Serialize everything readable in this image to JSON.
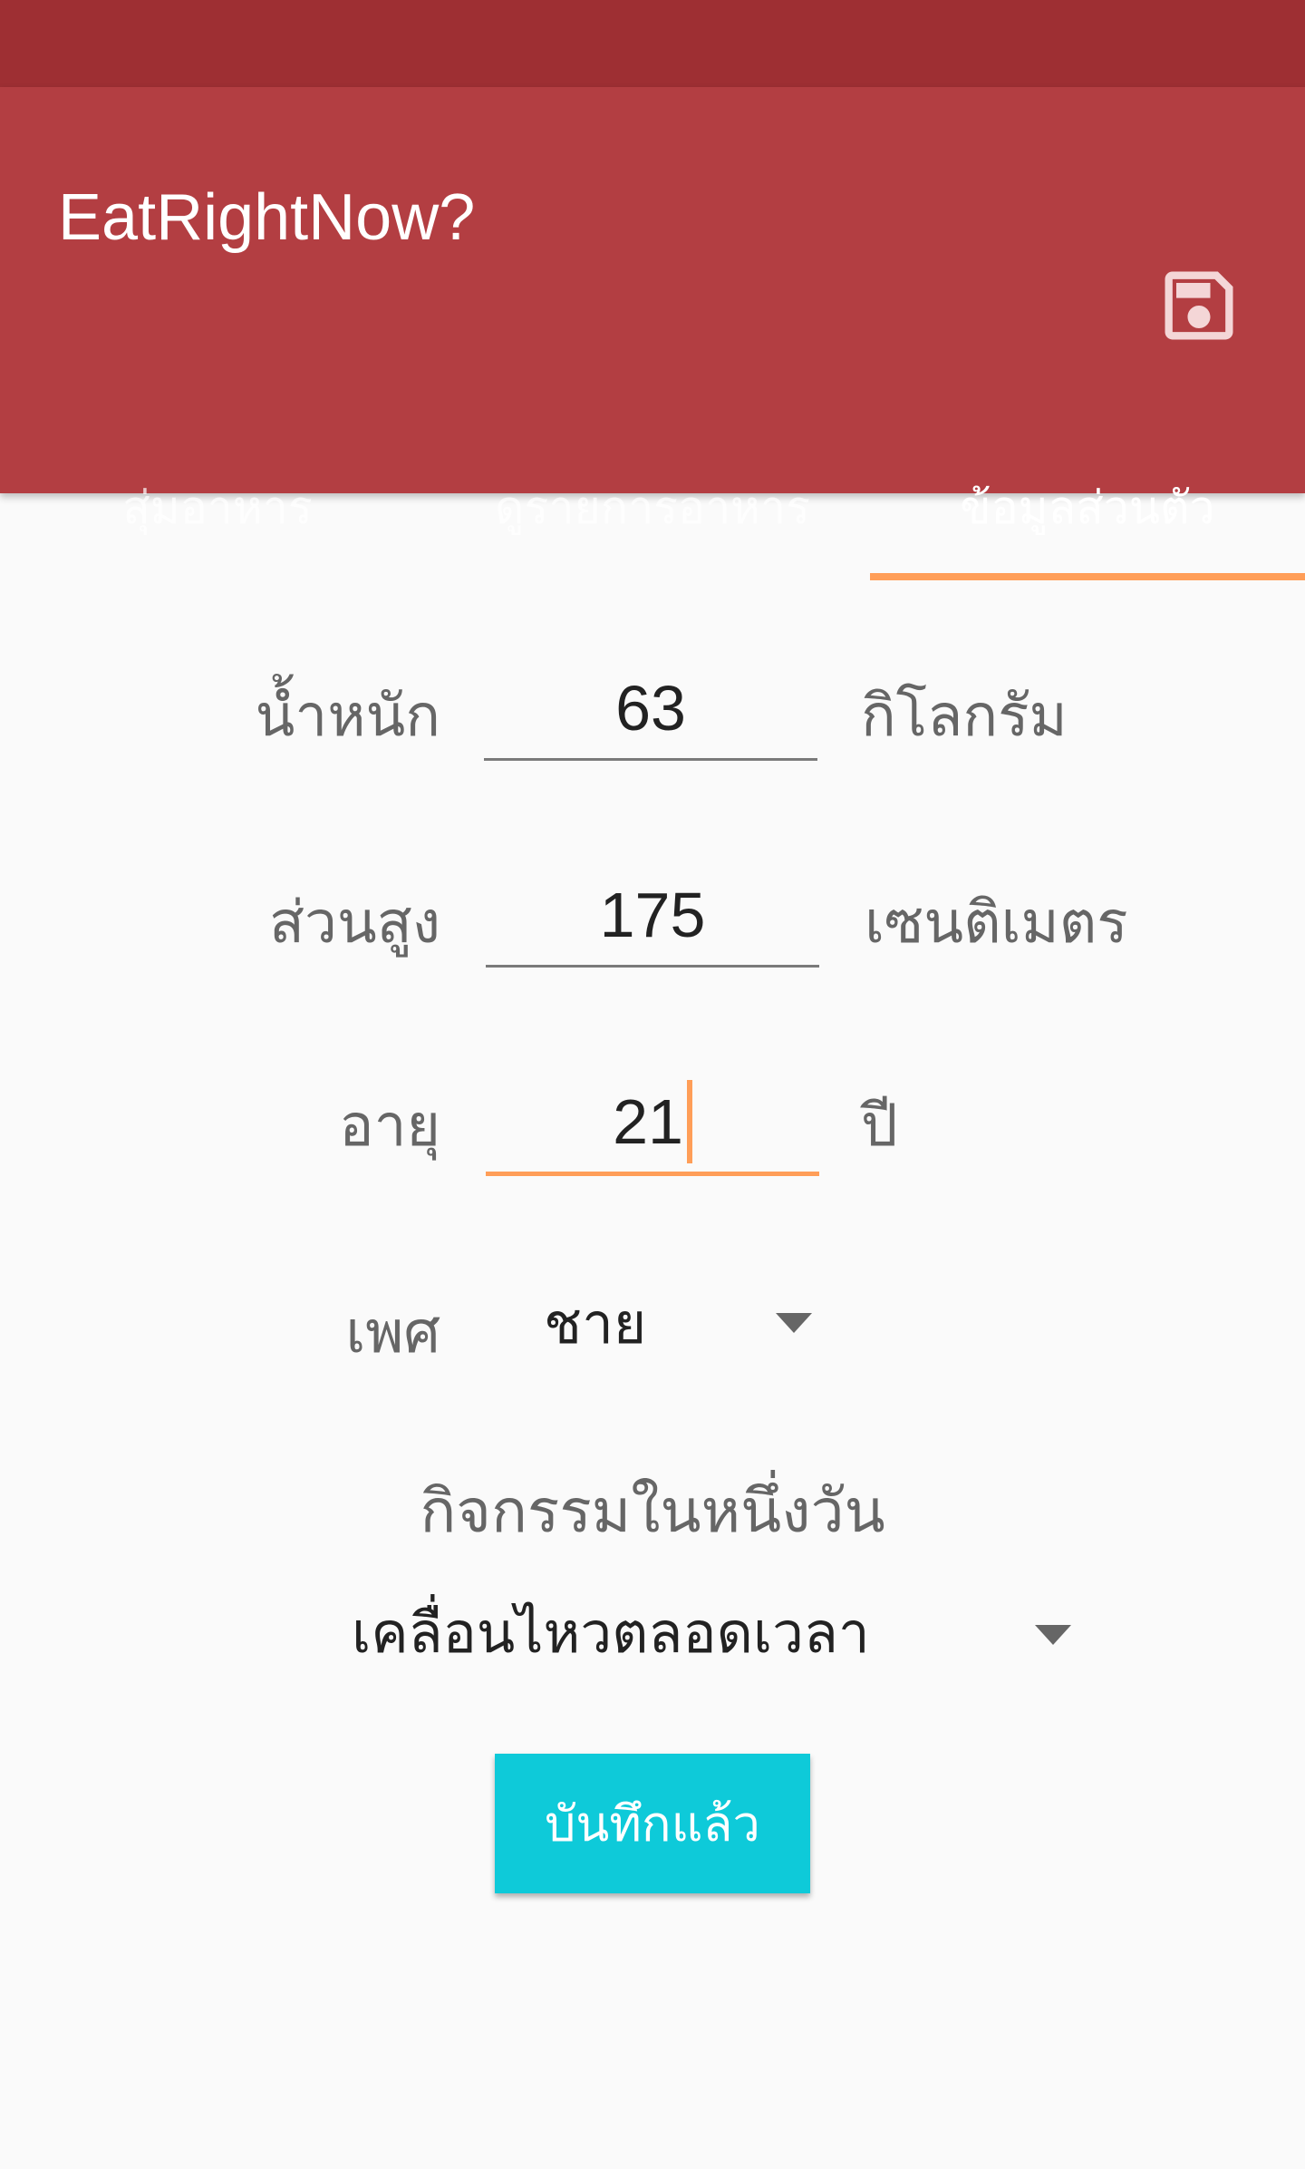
{
  "app": {
    "title": "EatRightNow?",
    "actions": {
      "save_icon": "floppy-disk-icon"
    }
  },
  "tabs": [
    {
      "label": "สุ่มอาหาร",
      "active": false
    },
    {
      "label": "ดูรายการอาหาร",
      "active": false
    },
    {
      "label": "ข้อมูลส่วนตัว",
      "active": true
    }
  ],
  "form": {
    "weight": {
      "label": "น้ำหนัก",
      "value": "63",
      "unit": "กิโลกรัม"
    },
    "height": {
      "label": "ส่วนสูง",
      "value": "175",
      "unit": "เซนติเมตร"
    },
    "age": {
      "label": "อายุ",
      "value": "21",
      "unit": "ปี"
    },
    "gender": {
      "label": "เพศ",
      "selected": "ชาย"
    },
    "activity": {
      "label": "กิจกรรมในหนึ่งวัน",
      "selected": "เคลื่อนไหวตลอดเวลา"
    },
    "save_button": "บันทึกแล้ว"
  },
  "colors": {
    "status_bar": "#9E2F33",
    "app_bar": "#B33E42",
    "accent": "#FF9E58",
    "button": "#0ECAD9"
  }
}
